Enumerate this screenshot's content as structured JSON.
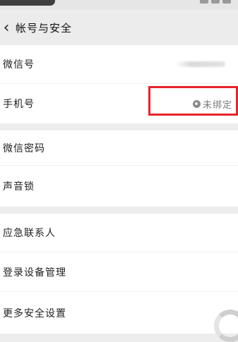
{
  "header": {
    "back_icon": "chevron-left-icon",
    "title": "帐号与安全"
  },
  "section1": {
    "wechat_id_label": "微信号",
    "phone_label": "手机号",
    "phone_status": "未绑定"
  },
  "section2": {
    "password_label": "微信密码",
    "voice_lock_label": "声音锁"
  },
  "section3": {
    "emergency_contact_label": "应急联系人",
    "device_management_label": "登录设备管理",
    "more_security_label": "更多安全设置"
  },
  "colors": {
    "highlight": "#e8232a",
    "background": "#ededed"
  }
}
